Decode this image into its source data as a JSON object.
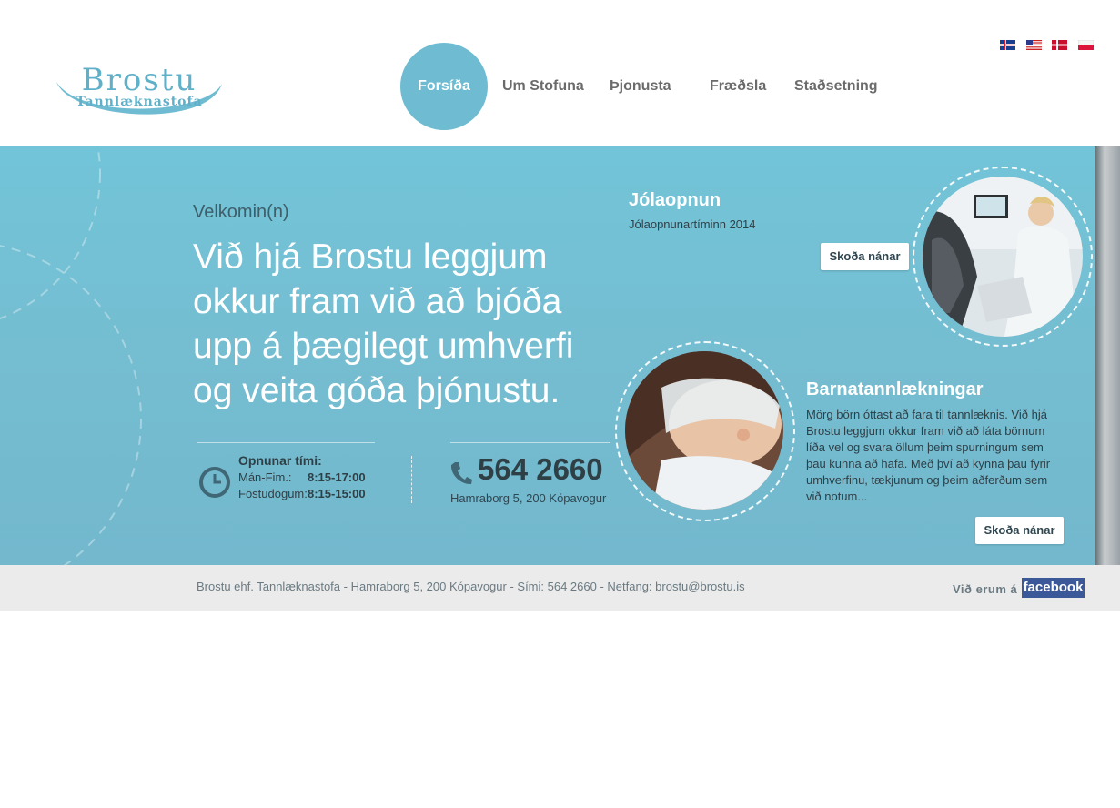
{
  "logo": {
    "name": "Brostu",
    "subtitle": "Tannlæknastofa"
  },
  "nav": [
    {
      "label": "Forsíða",
      "active": true
    },
    {
      "label": "Um Stofuna",
      "active": false
    },
    {
      "label": "Þjonusta",
      "active": false
    },
    {
      "label": "Fræðsla",
      "active": false
    },
    {
      "label": "Staðsetning",
      "active": false
    }
  ],
  "languages": [
    "Íslenska",
    "English",
    "Dansk",
    "Polski"
  ],
  "hero": {
    "welcome": "Velkomin(n)",
    "headline": "Við hjá Brostu leggjum okkur fram við að bjóða upp á þægilegt umhverfi og veita góða þjónustu.",
    "hours": {
      "title": "Opnunar tími:",
      "rows": [
        {
          "day": "Mán-Fim.:",
          "time": "8:15-17:00"
        },
        {
          "day": "Föstudögum:",
          "time": "8:15-15:00"
        }
      ],
      "icon": "clock-icon"
    },
    "contact": {
      "phone": "564 2660",
      "address": "Hamraborg 5, 200 Kópavogur",
      "icon": "phone-icon"
    }
  },
  "cards": [
    {
      "title": "Jólaopnun",
      "subtitle": "Jólaopnunartíminn 2014",
      "button": "Skoða nánar"
    },
    {
      "title": "Barnatannlækningar",
      "text": "Mörg börn óttast að fara til tannlæknis. Við hjá Brostu leggjum okkur fram við að láta börnum líða vel og svara öllum þeim spurningum sem þau kunna að hafa. Með því að kynna þau fyrir umhverfinu, tækjunum og þeim aðferðum sem við notum...",
      "button": "Skoða nánar"
    }
  ],
  "footer": {
    "text": "Brostu ehf. Tannlæknastofa - Hamraborg 5, 200 Kópavogur - Sími: 564 2660 - Netfang: brostu@brostu.is",
    "social_label": "Við erum á",
    "social_name": "facebook"
  },
  "colors": {
    "brand": "#6fbcd2",
    "hero_bg": "#75bdd1",
    "text_dark": "#2f3f46",
    "footer_bg": "#ebebeb",
    "facebook": "#3b5998"
  }
}
